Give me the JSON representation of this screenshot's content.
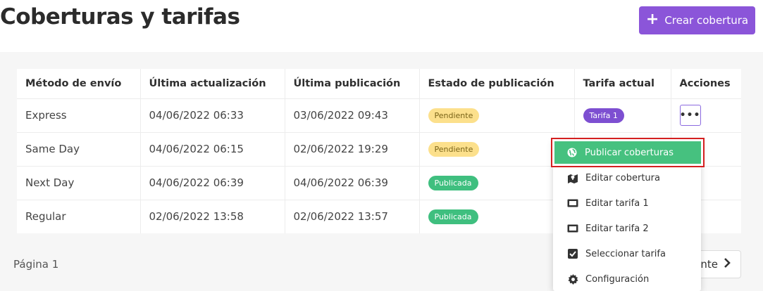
{
  "header": {
    "title": "Coberturas y tarifas",
    "create_button_label": "Crear cobertura"
  },
  "table": {
    "columns": [
      "Método de envío",
      "Última actualización",
      "Última publicación",
      "Estado de publicación",
      "Tarifa actual",
      "Acciones"
    ],
    "rows": [
      {
        "method": "Express",
        "updated": "04/06/2022 06:33",
        "published": "03/06/2022 09:43",
        "status": "Pendiente",
        "tariff": "Tarifa 1",
        "action": "•••"
      },
      {
        "method": "Same Day",
        "updated": "04/06/2022 06:15",
        "published": "02/06/2022 19:29",
        "status": "Pendiente",
        "tariff": "",
        "action": ""
      },
      {
        "method": "Next Day",
        "updated": "04/06/2022 06:39",
        "published": "04/06/2022 06:39",
        "status": "Publicada",
        "tariff": "",
        "action": ""
      },
      {
        "method": "Regular",
        "updated": "02/06/2022 13:58",
        "published": "02/06/2022 13:57",
        "status": "Publicada",
        "tariff": "",
        "action": ""
      }
    ]
  },
  "dropdown": {
    "items": [
      {
        "label": "Publicar coberturas",
        "icon": "globe-icon"
      },
      {
        "label": "Editar cobertura",
        "icon": "map-edit-icon"
      },
      {
        "label": "Editar tarifa 1",
        "icon": "ticket-icon"
      },
      {
        "label": "Editar tarifa 2",
        "icon": "ticket-icon"
      },
      {
        "label": "Seleccionar tarifa",
        "icon": "checkbox-icon"
      },
      {
        "label": "Configuración",
        "icon": "gear-icon"
      }
    ]
  },
  "footer": {
    "page_label": "Página 1",
    "next_label": "nte"
  },
  "colors": {
    "primary": "#8b55d9",
    "pending": "#fce08c",
    "published": "#3fbf7f",
    "highlight": "#46c17f",
    "focus_outline": "#d42020"
  }
}
